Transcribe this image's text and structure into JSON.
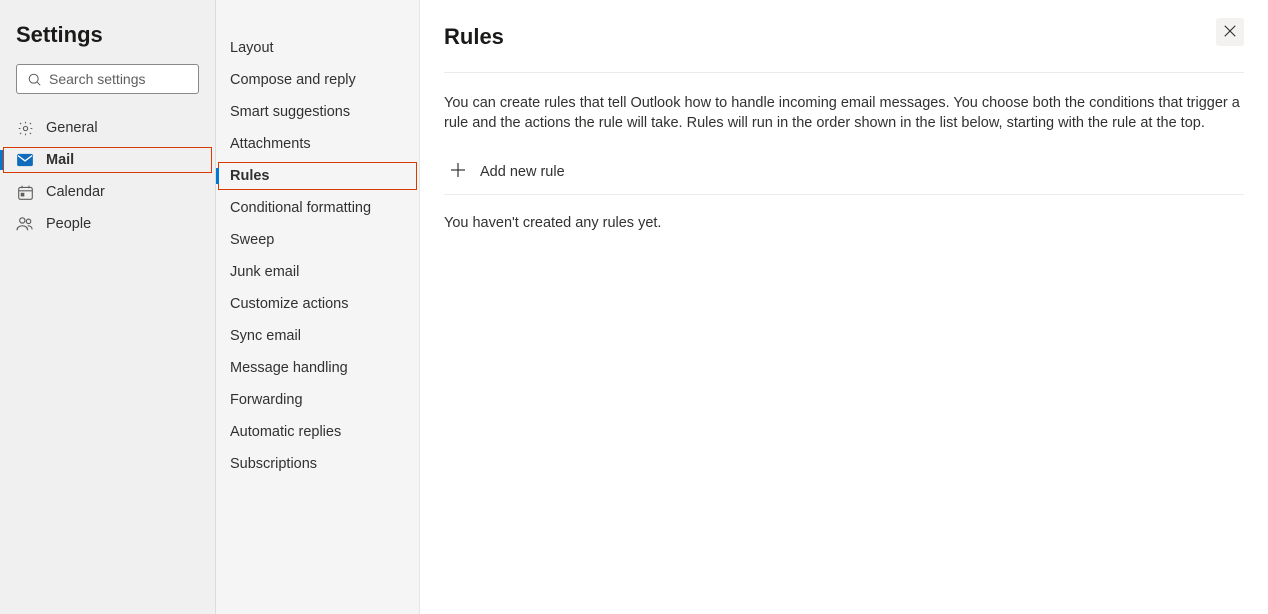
{
  "leftPanel": {
    "title": "Settings",
    "searchPlaceholder": "Search settings",
    "items": [
      {
        "label": "General",
        "icon": "gear"
      },
      {
        "label": "Mail",
        "icon": "mail"
      },
      {
        "label": "Calendar",
        "icon": "calendar"
      },
      {
        "label": "People",
        "icon": "people"
      }
    ]
  },
  "middlePanel": {
    "items": [
      "Layout",
      "Compose and reply",
      "Smart suggestions",
      "Attachments",
      "Rules",
      "Conditional formatting",
      "Sweep",
      "Junk email",
      "Customize actions",
      "Sync email",
      "Message handling",
      "Forwarding",
      "Automatic replies",
      "Subscriptions"
    ]
  },
  "mainPanel": {
    "title": "Rules",
    "description": "You can create rules that tell Outlook how to handle incoming email messages. You choose both the conditions that trigger a rule and the actions the rule will take. Rules will run in the order shown in the list below, starting with the rule at the top.",
    "addRuleLabel": "Add new rule",
    "emptyState": "You haven't created any rules yet."
  }
}
